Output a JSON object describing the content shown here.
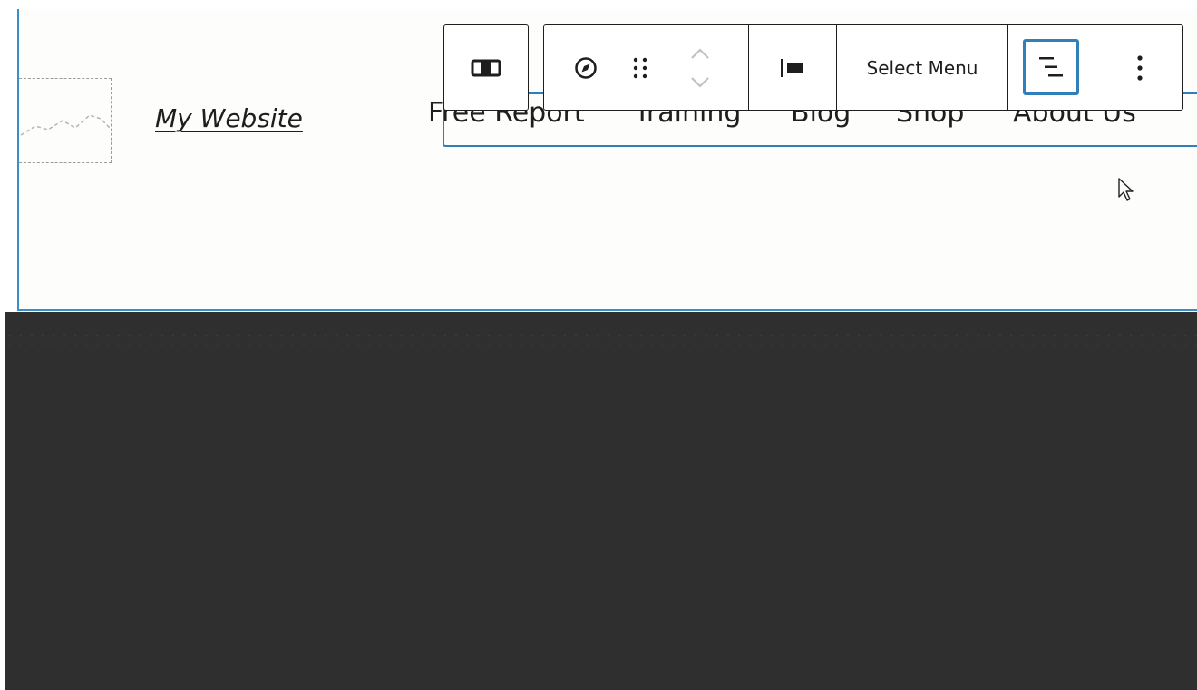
{
  "site": {
    "title": "My Website"
  },
  "navigation": {
    "items": [
      {
        "label": "Free Report"
      },
      {
        "label": "Training"
      },
      {
        "label": "Blog"
      },
      {
        "label": "Shop"
      },
      {
        "label": "About Us"
      }
    ]
  },
  "toolbar": {
    "select_menu_label": "Select Menu",
    "icons": {
      "parent": "site-header-template-icon",
      "block": "compass-icon",
      "drag": "drag-handle-icon",
      "move_up": "chevron-up-icon",
      "move_down": "chevron-down-icon",
      "justify": "justify-left-icon",
      "list_view": "list-view-icon",
      "more": "more-options-icon"
    }
  },
  "colors": {
    "selection_accent": "#2f7fba",
    "editor_background_dark": "#2f2f2f",
    "canvas_background": "#fdfdfc",
    "text": "#1e1e1e"
  }
}
